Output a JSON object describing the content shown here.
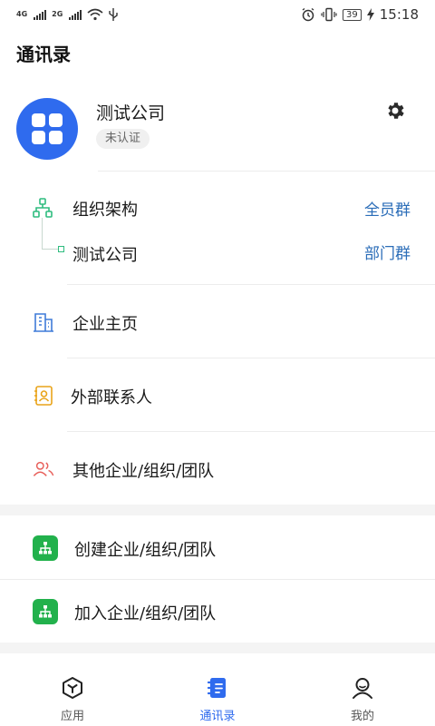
{
  "status_bar": {
    "net1": "4G",
    "net2": "2G",
    "battery": "39",
    "time": "15:18"
  },
  "page_title": "通讯录",
  "company": {
    "name": "测试公司",
    "badge": "未认证"
  },
  "org": {
    "title": "组织架构",
    "title_action": "全员群",
    "dept": "测试公司",
    "dept_action": "部门群"
  },
  "menu": {
    "homepage": "企业主页",
    "external_contacts": "外部联系人",
    "other_orgs": "其他企业/组织/团队",
    "create_org": "创建企业/组织/团队",
    "join_org": "加入企业/组织/团队"
  },
  "bottom_nav": {
    "apps": "应用",
    "contacts": "通讯录",
    "me": "我的"
  },
  "colors": {
    "accent": "#2f6bee",
    "link": "#2b6db8",
    "green": "#22b14c",
    "org_green": "#2ebc7f",
    "contacts_yellow": "#e9a41a",
    "other_red": "#e8605b"
  }
}
